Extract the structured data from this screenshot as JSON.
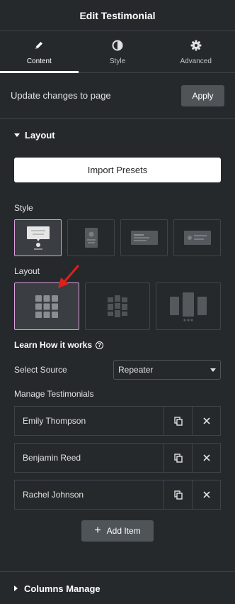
{
  "header": {
    "title": "Edit Testimonial"
  },
  "tabs": [
    {
      "label": "Content",
      "icon": "pencil-icon",
      "active": true
    },
    {
      "label": "Style",
      "icon": "half-circle-icon",
      "active": false
    },
    {
      "label": "Advanced",
      "icon": "gear-icon",
      "active": false
    }
  ],
  "update": {
    "text": "Update changes to page",
    "apply_label": "Apply"
  },
  "layout_section": {
    "title": "Layout"
  },
  "import_presets_label": "Import Presets",
  "style_label": "Style",
  "layout_label": "Layout",
  "learn_label": "Learn How it works",
  "source": {
    "label": "Select Source",
    "value": "Repeater"
  },
  "manage_label": "Manage Testimonials",
  "items": [
    {
      "title": "Emily Thompson"
    },
    {
      "title": "Benjamin Reed"
    },
    {
      "title": "Rachel Johnson"
    }
  ],
  "add_item_label": "Add Item",
  "columns_section": {
    "title": "Columns Manage"
  },
  "colors": {
    "background": "#26292c",
    "active_border": "#d9a1de",
    "annotation_arrow": "#e0201a"
  }
}
